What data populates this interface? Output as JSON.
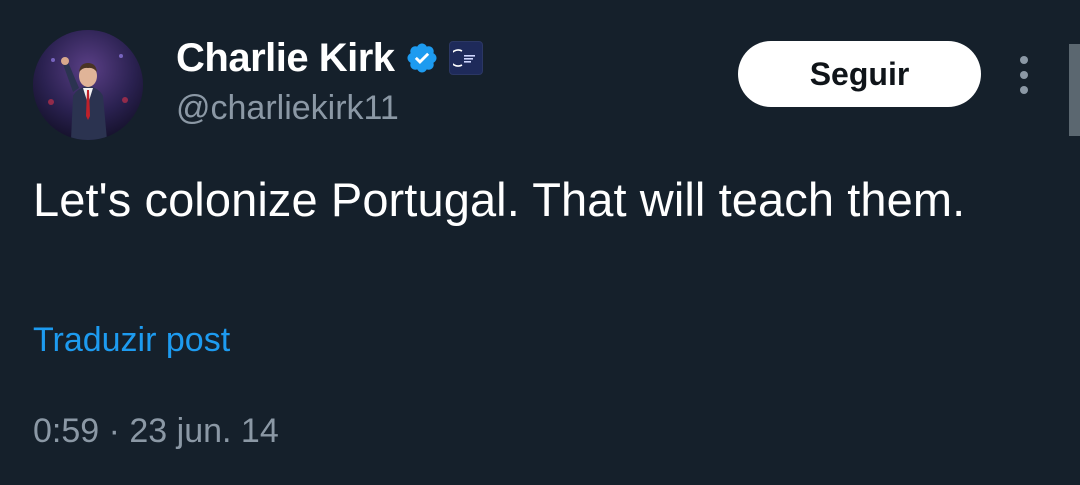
{
  "theme": {
    "background": "#15202b",
    "text_primary": "#ffffff",
    "text_secondary": "#8b98a5",
    "link": "#1d9bf0",
    "verified": "#1d9bf0"
  },
  "author": {
    "display_name": "Charlie Kirk",
    "handle": "@charliekirk11",
    "avatar_icon": "avatar-photo",
    "verified_icon": "verified-badge-icon",
    "affiliate_icon": "affiliate-org-badge-icon"
  },
  "actions": {
    "follow_label": "Seguir",
    "more_icon": "more-vertical-icon"
  },
  "tweet": {
    "text": "Let's colonize Portugal. That will teach them.",
    "translate_label": "Traduzir post",
    "timestamp": "0:59 · 23 jun. 14"
  }
}
